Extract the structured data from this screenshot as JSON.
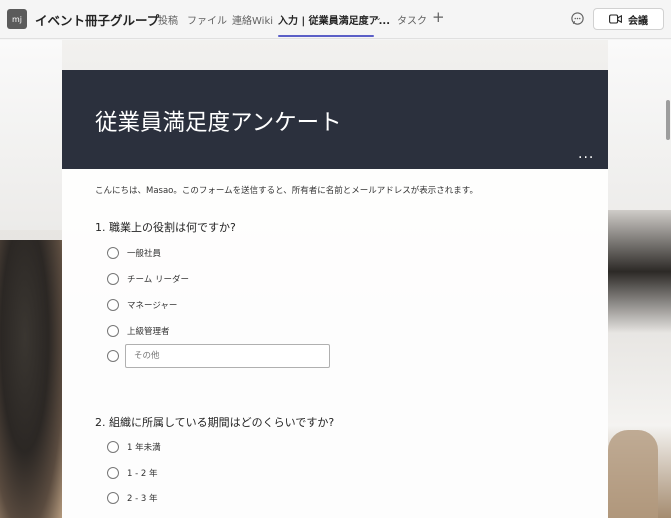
{
  "team": {
    "avatar_text": "mj",
    "name": "イベント冊子グループ"
  },
  "tabs": [
    {
      "label": "投稿"
    },
    {
      "label": "ファイル"
    },
    {
      "label": "連絡Wiki"
    },
    {
      "label": "入力 | 従業員満足度ア..."
    },
    {
      "label": "タスク"
    }
  ],
  "header_actions": {
    "add_tab": "+",
    "meet_label": "会議"
  },
  "form": {
    "title": "従業員満足度アンケート",
    "more": "...",
    "intro": "こんにちは、Masao。このフォームを送信すると、所有者に名前とメールアドレスが表示されます。",
    "questions": [
      {
        "title": "1. 職業上の役割は何ですか?",
        "options": [
          "一般社員",
          "チーム リーダー",
          "マネージャー",
          "上級管理者"
        ],
        "other_placeholder": "その他"
      },
      {
        "title": "2. 組織に所属している期間はどのくらいですか?",
        "options": [
          "1 年未満",
          "1 - 2 年",
          "2 - 3 年"
        ]
      }
    ]
  },
  "colors": {
    "accent": "#5b5fc7",
    "form_header": "#2b303d"
  }
}
